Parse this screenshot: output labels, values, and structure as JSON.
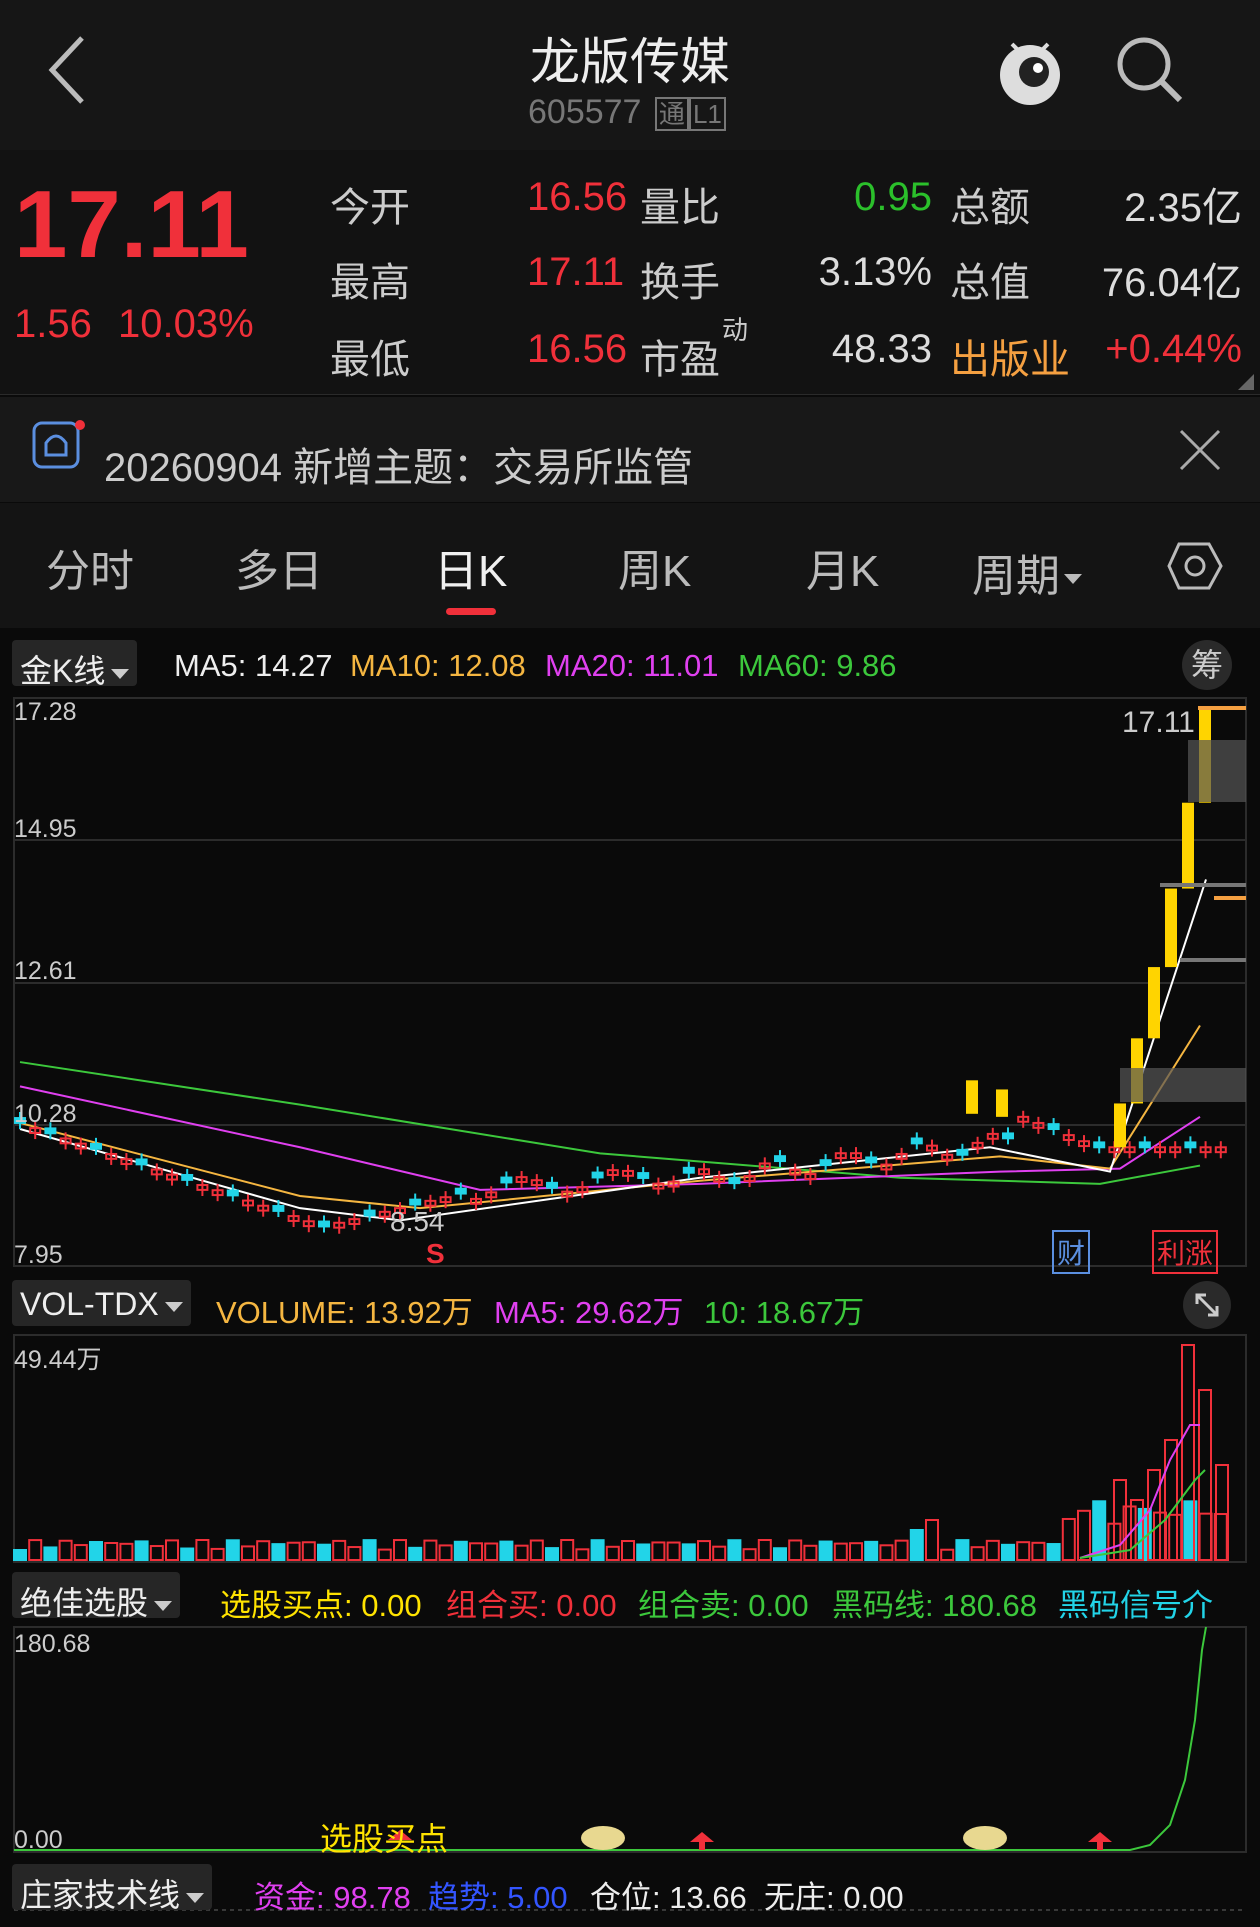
{
  "header": {
    "title": "龙版传媒",
    "code": "605577",
    "tag_tong": "通",
    "tag_l1": "L1",
    "icons": [
      "back-icon",
      "mascot-icon",
      "search-icon"
    ]
  },
  "quote": {
    "price": "17.11",
    "change": "1.56",
    "change_pct": "10.03%",
    "rows": [
      {
        "l1": "今开",
        "v1": "16.56",
        "l2": "量比",
        "v2": "0.95",
        "l3": "总额",
        "v3": "2.35亿"
      },
      {
        "l1": "最高",
        "v1": "17.11",
        "l2": "换手",
        "v2": "3.13%",
        "l3": "总值",
        "v3": "76.04亿"
      },
      {
        "l1": "最低",
        "v1": "16.56",
        "l2": "市盈",
        "l2_sup": "动",
        "v2": "48.33",
        "l3": "出版业",
        "v3": "+0.44%"
      }
    ]
  },
  "notice": {
    "text": "20260904 新增主题：交易所监管"
  },
  "tabs": {
    "items": [
      "分时",
      "多日",
      "日K",
      "周K",
      "月K"
    ],
    "period": "周期",
    "active": "日K"
  },
  "kline": {
    "selector": "金K线",
    "ma5": "MA5: 14.27",
    "ma10": "MA10: 12.08",
    "ma20": "MA20: 11.01",
    "ma60": "MA60: 9.86",
    "chip_btn": "筹",
    "y_labels": [
      "17.28",
      "14.95",
      "12.61",
      "10.28",
      "7.95"
    ],
    "last_price": "17.11",
    "low_label": "8.54",
    "s_marker": "S",
    "badge_cai": "财",
    "badge_zhang": "利涨",
    "colors": {
      "up": "#f0303a",
      "down": "#22d4e8",
      "limit": "#ffd400",
      "ma5": "#ffffff",
      "ma10": "#f5b641",
      "ma20": "#e040f0",
      "ma60": "#3cc83c"
    }
  },
  "volume": {
    "selector": "VOL-TDX",
    "volume": "VOLUME: 13.92万",
    "ma5": "MA5: 29.62万",
    "ma10": "10: 18.67万",
    "max_label": "49.44万"
  },
  "jiajia": {
    "selector": "绝佳选股",
    "buy_point": "选股买点: 0.00",
    "combo_buy": "组合买: 0.00",
    "combo_sell": "组合卖: 0.00",
    "heima": "黑码线: 180.68",
    "heima_signal": "黑码信号介",
    "y_top": "180.68",
    "y_bottom": "0.00",
    "marker_label": "选股买点"
  },
  "zhuangjia": {
    "selector": "庄家技术线",
    "fund": "资金: 98.78",
    "trend": "趋势: 5.00",
    "position": "仓位: 13.66",
    "no_dealer": "无庄: 0.00"
  }
}
